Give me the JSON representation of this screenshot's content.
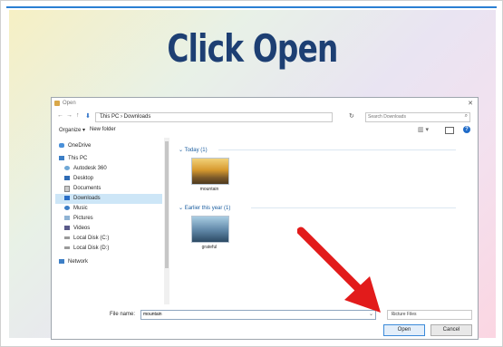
{
  "slide": {
    "title": "Click Open",
    "colors": {
      "title": "#1d3f73",
      "arrow": "#e21b1b",
      "top_line": "#2a7fd3"
    }
  },
  "dialog": {
    "title": "Open",
    "address": {
      "path": "This PC  ›  Downloads"
    },
    "search": {
      "placeholder": "Search Downloads"
    },
    "toolbar": {
      "organize": "Organize ▾",
      "new_folder": "New folder"
    },
    "nav_items": [
      {
        "label": "OneDrive",
        "icon": "cloud-icon"
      },
      {
        "label": "This PC",
        "icon": "computer-icon"
      },
      {
        "label": "Autodesk 360",
        "icon": "autodesk-icon"
      },
      {
        "label": "Desktop",
        "icon": "desktop-icon"
      },
      {
        "label": "Documents",
        "icon": "documents-icon"
      },
      {
        "label": "Downloads",
        "icon": "download-icon",
        "selected": true
      },
      {
        "label": "Music",
        "icon": "music-icon"
      },
      {
        "label": "Pictures",
        "icon": "pictures-icon"
      },
      {
        "label": "Videos",
        "icon": "videos-icon"
      },
      {
        "label": "Local Disk (C:)",
        "icon": "drive-icon"
      },
      {
        "label": "Local Disk (D:)",
        "icon": "drive-icon"
      },
      {
        "label": "Network",
        "icon": "network-icon"
      }
    ],
    "groups": [
      {
        "header": "Today (1)",
        "files": [
          {
            "name": "mountain"
          }
        ]
      },
      {
        "header": "Earlier this year (1)",
        "files": [
          {
            "name": "grateful"
          }
        ]
      }
    ],
    "file_name": {
      "label": "File name:",
      "value": "mountain"
    },
    "file_type": {
      "value": "Picture Files"
    },
    "buttons": {
      "open": "Open",
      "cancel": "Cancel"
    }
  }
}
